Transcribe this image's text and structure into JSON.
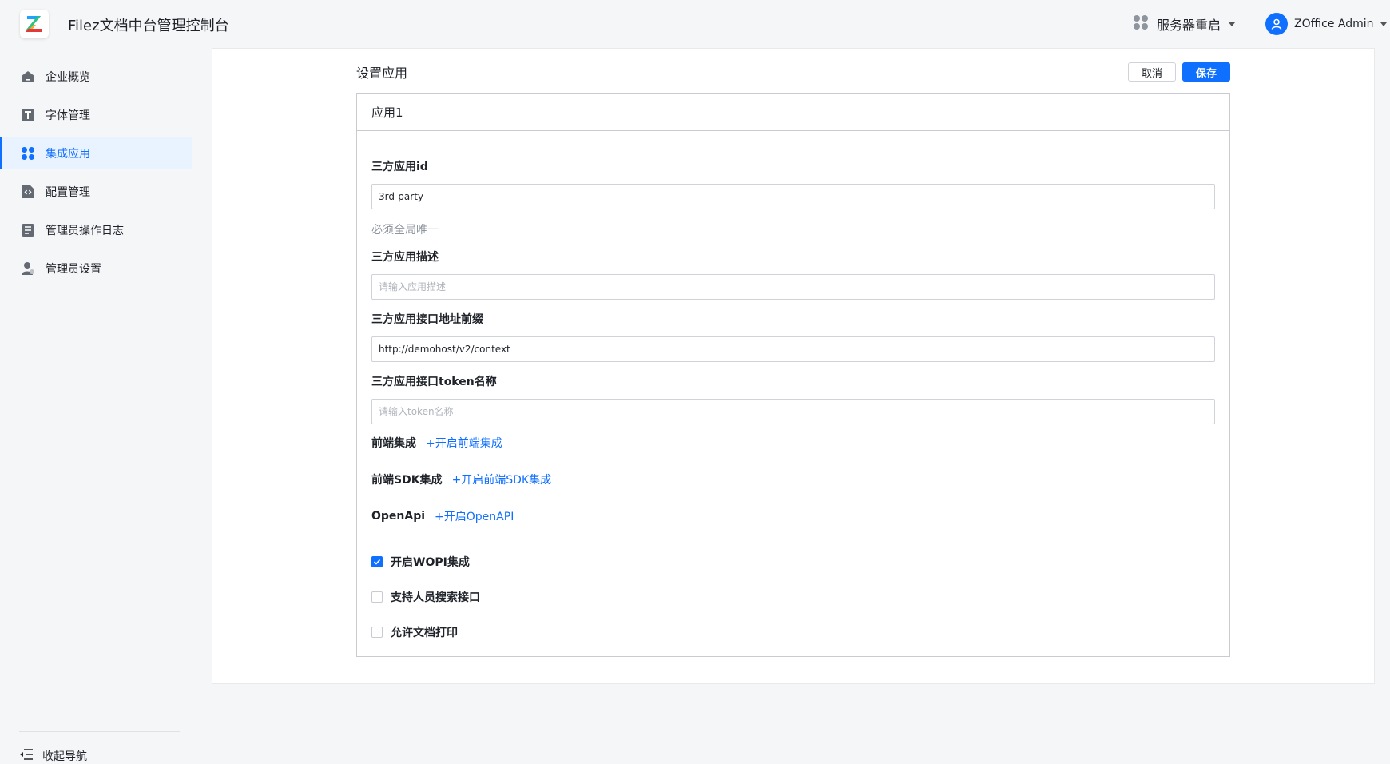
{
  "header": {
    "app_title": "Filez文档中台管理控制台",
    "restart_label": "服务器重启",
    "user_name": "ZOffice Admin",
    "brand_color": "#0f6fff"
  },
  "sidebar": {
    "items": [
      {
        "label": "企业概览",
        "icon": "home-icon",
        "active": false
      },
      {
        "label": "字体管理",
        "icon": "font-icon",
        "active": false
      },
      {
        "label": "集成应用",
        "icon": "apps-grid-icon",
        "active": true
      },
      {
        "label": "配置管理",
        "icon": "config-icon",
        "active": false
      },
      {
        "label": "管理员操作日志",
        "icon": "log-icon",
        "active": false
      },
      {
        "label": "管理员设置",
        "icon": "admin-user-icon",
        "active": false
      }
    ],
    "collapse_label": "收起导航"
  },
  "page": {
    "title": "设置应用",
    "cancel_label": "取消",
    "save_label": "保存"
  },
  "form": {
    "card_title": "应用1",
    "app_id": {
      "label": "三方应用id",
      "value": "3rd-party",
      "hint": "必须全局唯一"
    },
    "description": {
      "label": "三方应用描述",
      "placeholder": "请输入应用描述"
    },
    "api_prefix": {
      "label": "三方应用接口地址前缀",
      "value": "http://demohost/v2/context"
    },
    "token_name": {
      "label": "三方应用接口token名称",
      "placeholder": "请输入token名称"
    },
    "frontend": {
      "label": "前端集成",
      "link": "+开启前端集成"
    },
    "frontend_sdk": {
      "label": "前端SDK集成",
      "link": "+开启前端SDK集成"
    },
    "openapi": {
      "label": "OpenApi",
      "link": "+开启OpenAPI"
    },
    "checkboxes": [
      {
        "label": "开启WOPI集成",
        "checked": true
      },
      {
        "label": "支持人员搜索接口",
        "checked": false
      },
      {
        "label": "允许文档打印",
        "checked": false
      }
    ]
  }
}
